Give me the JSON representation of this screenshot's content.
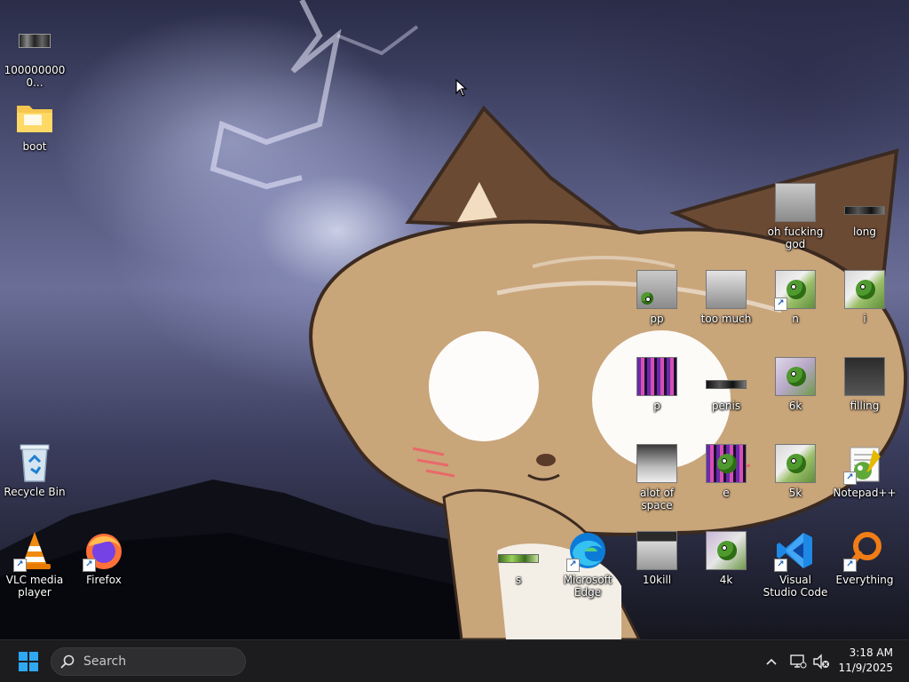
{
  "desktop": {
    "left_icons": [
      {
        "label": "1000000000...",
        "kind": "image-strip"
      },
      {
        "label": "boot",
        "kind": "folder"
      },
      {
        "label": "Recycle Bin",
        "kind": "recycle-bin"
      },
      {
        "label": "VLC media player",
        "kind": "vlc-shortcut"
      },
      {
        "label": "Firefox",
        "kind": "firefox-shortcut"
      }
    ],
    "grid_icons": [
      {
        "label": "oh fucking god"
      },
      {
        "label": "long"
      },
      {
        "label": "pp"
      },
      {
        "label": "too much"
      },
      {
        "label": "n"
      },
      {
        "label": "i"
      },
      {
        "label": "p"
      },
      {
        "label": "penis"
      },
      {
        "label": "6k"
      },
      {
        "label": "filling"
      },
      {
        "label": "alot of space"
      },
      {
        "label": "e"
      },
      {
        "label": "5k"
      },
      {
        "label": "Notepad++"
      },
      {
        "label": "s"
      },
      {
        "label": "Microsoft Edge"
      },
      {
        "label": "10kill"
      },
      {
        "label": "4k"
      },
      {
        "label": "Visual Studio Code"
      },
      {
        "label": "Everything"
      }
    ]
  },
  "taskbar": {
    "search_label": "Search",
    "time": "3:18 AM",
    "date": "11/9/2025"
  },
  "colors": {
    "taskbar_bg": "#1c1c1e",
    "windows_blue": "#2fa8f3",
    "vscode_blue": "#1e88e5",
    "everything_orange": "#f07d16"
  }
}
